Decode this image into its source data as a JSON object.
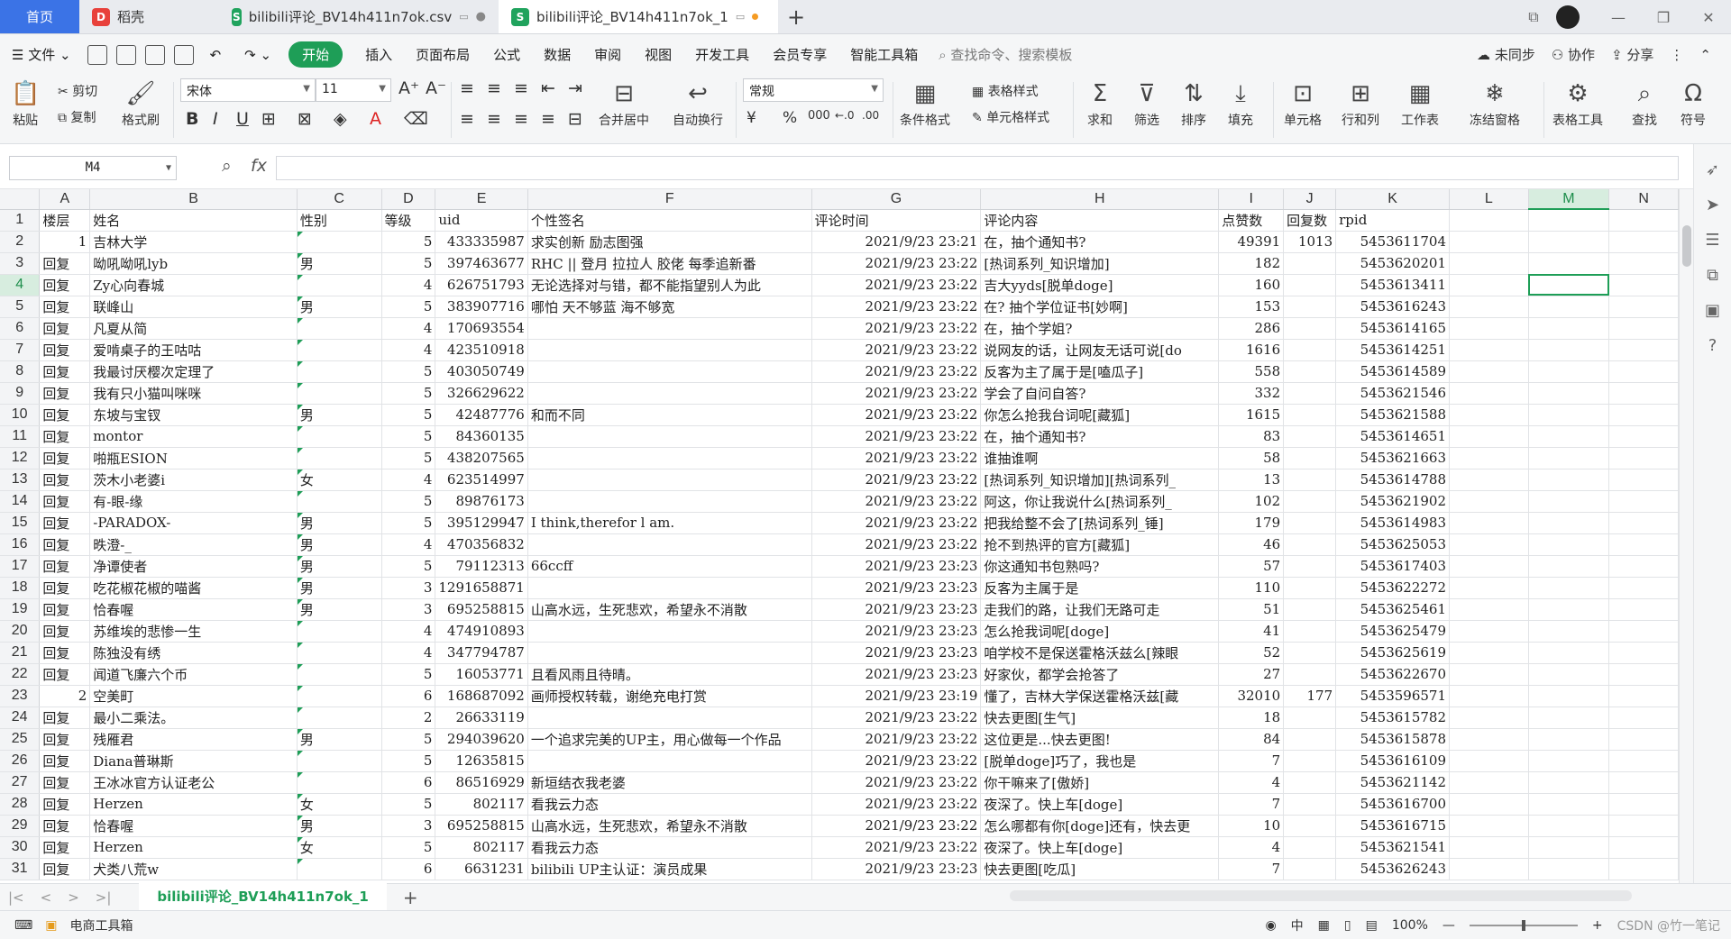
{
  "tabs": [
    {
      "label": "首页"
    },
    {
      "label": "稻壳"
    },
    {
      "label": "bilibili评论_BV14h411n7ok.csv"
    },
    {
      "label": "bilibili评论_BV14h411n7ok_1"
    }
  ],
  "menubar": {
    "file": "文件",
    "items": [
      "开始",
      "插入",
      "页面布局",
      "公式",
      "数据",
      "审阅",
      "视图",
      "开发工具",
      "会员专享",
      "智能工具箱"
    ],
    "search": "查找命令、搜索模板",
    "sync": "未同步",
    "collab": "协作",
    "share": "分享"
  },
  "ribbon": {
    "paste": "粘贴",
    "cut": "剪切",
    "copy": "复制",
    "format_painter": "格式刷",
    "font": "宋体",
    "font_size": "11",
    "merge": "合并居中",
    "wrap": "自动换行",
    "number_format": "常规",
    "cond_format": "条件格式",
    "table_style": "表格样式",
    "cell_style": "单元格样式",
    "sum": "求和",
    "filter": "筛选",
    "sort": "排序",
    "fill": "填充",
    "cell": "单元格",
    "rowcol": "行和列",
    "sheet": "工作表",
    "freeze": "冻结窗格",
    "table_tools": "表格工具",
    "find": "查找",
    "symbol": "符号"
  },
  "formula": {
    "namebox": "M4",
    "fx": "fx",
    "value": ""
  },
  "columns": [
    "",
    "A",
    "B",
    "C",
    "D",
    "E",
    "F",
    "G",
    "H",
    "I",
    "J",
    "K",
    "L",
    "M",
    "N"
  ],
  "rows": [
    [
      "1",
      "楼层",
      "姓名",
      "性别",
      "等级",
      "uid",
      "个性签名",
      "评论时间",
      "评论内容",
      "点赞数",
      "回复数",
      "rpid",
      "",
      "",
      ""
    ],
    [
      "2",
      "1",
      "吉林大学",
      "",
      "5",
      "433335987",
      "求实创新 励志图强",
      "2021/9/23 23:21",
      "在，抽个通知书?",
      "49391",
      "1013",
      "5453611704",
      "",
      "",
      ""
    ],
    [
      "3",
      "回复",
      "呦吼呦吼lyb",
      "男",
      "5",
      "397463677",
      "RHC || 登月 拉拉人 胶佬 每季追新番",
      "2021/9/23 23:22",
      "[热词系列_知识增加]",
      "182",
      "",
      "5453620201",
      "",
      "",
      ""
    ],
    [
      "4",
      "回复",
      "Zy心向春城",
      "",
      "4",
      "626751793",
      "无论选择对与错，都不能指望别人为此",
      "2021/9/23 23:22",
      "吉大yyds[脱单doge]",
      "160",
      "",
      "5453613411",
      "",
      "",
      ""
    ],
    [
      "5",
      "回复",
      "联峰山",
      "男",
      "5",
      "383907716",
      "哪怕 天不够蓝 海不够宽",
      "2021/9/23 23:22",
      "在? 抽个学位证书[妙啊]",
      "153",
      "",
      "5453616243",
      "",
      "",
      ""
    ],
    [
      "6",
      "回复",
      "凡夏从简",
      "",
      "4",
      "170693554",
      "",
      "2021/9/23 23:22",
      "在，抽个学姐?",
      "286",
      "",
      "5453614165",
      "",
      "",
      ""
    ],
    [
      "7",
      "回复",
      "爱啃桌子的王咕咕",
      "",
      "4",
      "423510918",
      "",
      "2021/9/23 23:22",
      "说网友的话，让网友无话可说[do",
      "1616",
      "",
      "5453614251",
      "",
      "",
      ""
    ],
    [
      "8",
      "回复",
      "我最讨厌樱次定理了",
      "",
      "5",
      "403050749",
      "",
      "2021/9/23 23:22",
      "反客为主了属于是[嗑瓜子]",
      "558",
      "",
      "5453614589",
      "",
      "",
      ""
    ],
    [
      "9",
      "回复",
      "我有只小猫叫咪咪",
      "",
      "5",
      "326629622",
      "",
      "2021/9/23 23:22",
      "学会了自问自答?",
      "332",
      "",
      "5453621546",
      "",
      "",
      ""
    ],
    [
      "10",
      "回复",
      "东坡与宝钗",
      "男",
      "5",
      "42487776",
      "和而不同",
      "2021/9/23 23:22",
      "你怎么抢我台词呢[藏狐]",
      "1615",
      "",
      "5453621588",
      "",
      "",
      ""
    ],
    [
      "11",
      "回复",
      "montor",
      "",
      "5",
      "84360135",
      "",
      "2021/9/23 23:22",
      "在，抽个通知书?",
      "83",
      "",
      "5453614651",
      "",
      "",
      ""
    ],
    [
      "12",
      "回复",
      "啪瓶ESION",
      "",
      "5",
      "438207565",
      "",
      "2021/9/23 23:22",
      "谁抽谁啊",
      "58",
      "",
      "5453621663",
      "",
      "",
      ""
    ],
    [
      "13",
      "回复",
      "茨木小老婆i",
      "女",
      "4",
      "623514997",
      "",
      "2021/9/23 23:22",
      "[热词系列_知识增加][热词系列_",
      "13",
      "",
      "5453614788",
      "",
      "",
      ""
    ],
    [
      "14",
      "回复",
      "有-眼-缘",
      "",
      "5",
      "89876173",
      "",
      "2021/9/23 23:22",
      "阿这，你让我说什么[热词系列_",
      "102",
      "",
      "5453621902",
      "",
      "",
      ""
    ],
    [
      "15",
      "回复",
      "-PARADOX-",
      "男",
      "5",
      "395129947",
      "I think,therefor l am.",
      "2021/9/23 23:22",
      "把我给整不会了[热词系列_锤]",
      "179",
      "",
      "5453614983",
      "",
      "",
      ""
    ],
    [
      "16",
      "回复",
      "昳澄-_",
      "男",
      "4",
      "470356832",
      "",
      "2021/9/23 23:22",
      "抢不到热评的官方[藏狐]",
      "46",
      "",
      "5453625053",
      "",
      "",
      ""
    ],
    [
      "17",
      "回复",
      "净谭使者",
      "男",
      "5",
      "79112313",
      "66ccff",
      "2021/9/23 23:23",
      "你这通知书包熟吗?",
      "57",
      "",
      "5453617403",
      "",
      "",
      ""
    ],
    [
      "18",
      "回复",
      "吃花椒花椒的喵酱",
      "男",
      "3",
      "1291658871",
      "",
      "2021/9/23 23:23",
      "反客为主属于是",
      "110",
      "",
      "5453622272",
      "",
      "",
      ""
    ],
    [
      "19",
      "回复",
      "恰春喔",
      "男",
      "3",
      "695258815",
      "山高水远，生死悲欢，希望永不消散",
      "2021/9/23 23:23",
      "走我们的路，让我们无路可走",
      "51",
      "",
      "5453625461",
      "",
      "",
      ""
    ],
    [
      "20",
      "回复",
      "苏维埃的悲惨一生",
      "",
      "4",
      "474910893",
      "",
      "2021/9/23 23:23",
      "怎么抢我词呢[doge]",
      "41",
      "",
      "5453625479",
      "",
      "",
      ""
    ],
    [
      "21",
      "回复",
      "陈独没有绣",
      "",
      "4",
      "347794787",
      "",
      "2021/9/23 23:23",
      "咱学校不是保送霍格沃兹么[辣眼",
      "52",
      "",
      "5453625619",
      "",
      "",
      ""
    ],
    [
      "22",
      "回复",
      "闻道飞廉六个币",
      "",
      "5",
      "16053771",
      "且看风雨且待晴。",
      "2021/9/23 23:23",
      "好家伙，都学会抢答了",
      "27",
      "",
      "5453622670",
      "",
      "",
      ""
    ],
    [
      "23",
      "2",
      "空美町",
      "",
      "6",
      "168687092",
      "画师授权转载，谢绝充电打赏",
      "2021/9/23 23:19",
      "懂了，吉林大学保送霍格沃兹[藏",
      "32010",
      "177",
      "5453596571",
      "",
      "",
      ""
    ],
    [
      "24",
      "回复",
      "最小二乘法。",
      "",
      "2",
      "26633119",
      "",
      "2021/9/23 23:22",
      "快去更图[生气]",
      "18",
      "",
      "5453615782",
      "",
      "",
      ""
    ],
    [
      "25",
      "回复",
      "残雁君",
      "男",
      "5",
      "294039620",
      "一个追求完美的UP主，用心做每一个作品",
      "2021/9/23 23:22",
      "这位更是...快去更图!",
      "84",
      "",
      "5453615878",
      "",
      "",
      ""
    ],
    [
      "26",
      "回复",
      "Diana普琳斯",
      "",
      "5",
      "12635815",
      "",
      "2021/9/23 23:22",
      "[脱单doge]巧了，我也是",
      "7",
      "",
      "5453616109",
      "",
      "",
      ""
    ],
    [
      "27",
      "回复",
      "王冰冰官方认证老公",
      "",
      "6",
      "86516929",
      "新垣结衣我老婆",
      "2021/9/23 23:22",
      "你干嘛来了[傲娇]",
      "4",
      "",
      "5453621142",
      "",
      "",
      ""
    ],
    [
      "28",
      "回复",
      "Herzen",
      "女",
      "5",
      "802117",
      "看我云力态",
      "2021/9/23 23:22",
      "夜深了。快上车[doge]",
      "7",
      "",
      "5453616700",
      "",
      "",
      ""
    ],
    [
      "29",
      "回复",
      "恰春喔",
      "男",
      "3",
      "695258815",
      "山高水远，生死悲欢，希望永不消散",
      "2021/9/23 23:22",
      "怎么哪都有你[doge]还有，快去更",
      "10",
      "",
      "5453616715",
      "",
      "",
      ""
    ],
    [
      "30",
      "回复",
      "Herzen",
      "女",
      "5",
      "802117",
      "看我云力态",
      "2021/9/23 23:22",
      "夜深了。快上车[doge]",
      "4",
      "",
      "5453621541",
      "",
      "",
      ""
    ],
    [
      "31",
      "回复",
      "犬类八荒w",
      "",
      "6",
      "6631231",
      "bilibili UP主认证：演员成果",
      "2021/9/23 23:23",
      "快去更图[吃瓜]",
      "7",
      "",
      "5453626243",
      "",
      "",
      ""
    ]
  ],
  "sheet_tab": "bilibili评论_BV14h411n7ok_1",
  "statusbar": {
    "toolbox": "电商工具箱",
    "zoom": "100%",
    "watermark": "CSDN @竹一笔记"
  }
}
